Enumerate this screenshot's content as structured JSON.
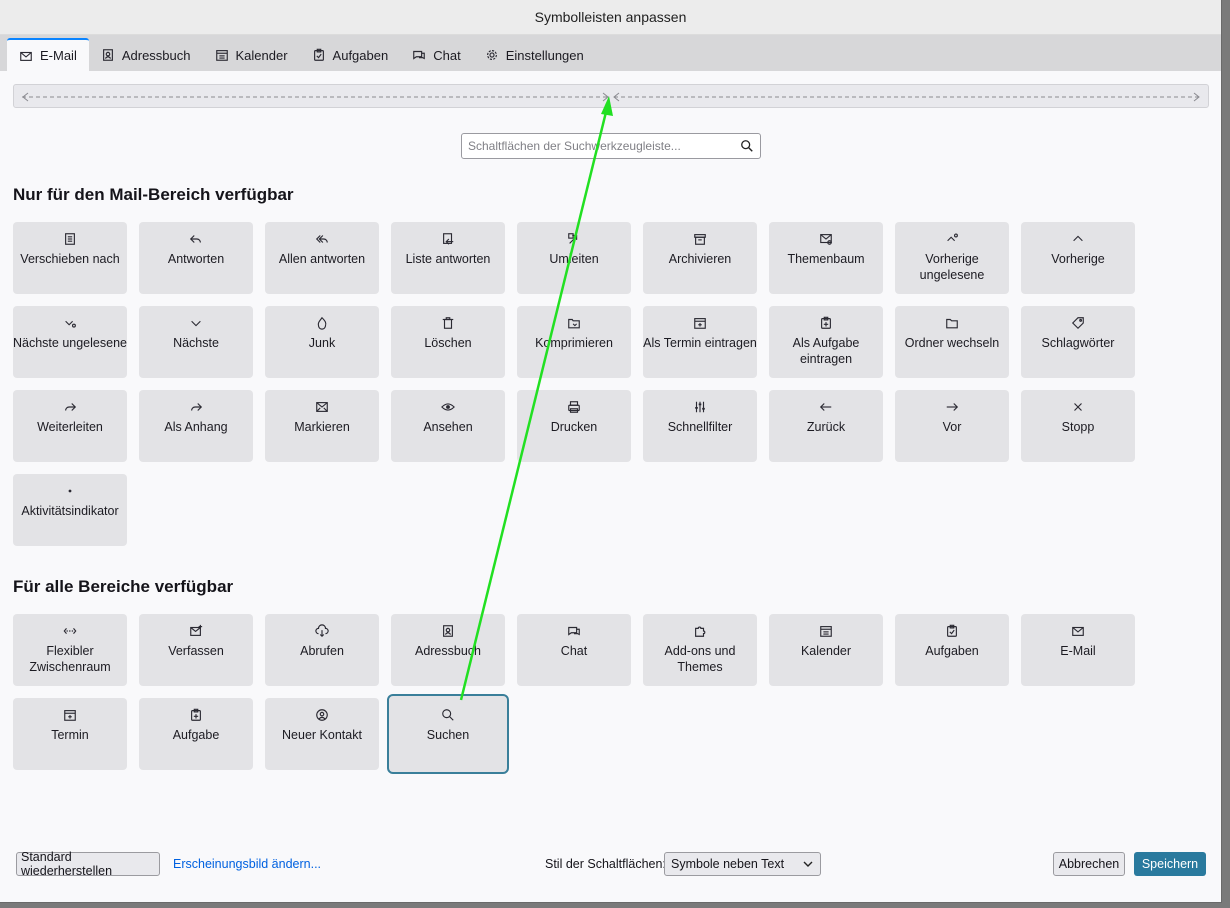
{
  "window": {
    "title": "Symbolleisten anpassen"
  },
  "tabs": [
    {
      "label": "E-Mail",
      "icon": "mail-icon",
      "active": true
    },
    {
      "label": "Adressbuch",
      "icon": "addressbook-icon"
    },
    {
      "label": "Kalender",
      "icon": "calendar-icon"
    },
    {
      "label": "Aufgaben",
      "icon": "tasks-icon"
    },
    {
      "label": "Chat",
      "icon": "chat-icon"
    },
    {
      "label": "Einstellungen",
      "icon": "gear-icon"
    }
  ],
  "search": {
    "placeholder": "Schaltflächen der Suchwerkzeugleiste..."
  },
  "section_mail": {
    "title": "Nur für den Mail-Bereich verfügbar",
    "items": [
      {
        "label": "Verschieben nach",
        "icon": "move-icon"
      },
      {
        "label": "Antworten",
        "icon": "reply-icon"
      },
      {
        "label": "Allen antworten",
        "icon": "reply-all-icon"
      },
      {
        "label": "Liste antworten",
        "icon": "reply-list-icon"
      },
      {
        "label": "Umleiten",
        "icon": "redirect-icon"
      },
      {
        "label": "Archivieren",
        "icon": "archive-icon"
      },
      {
        "label": "Themenbaum",
        "icon": "thread-icon"
      },
      {
        "label": "Vorherige ungelesene",
        "icon": "previous-unread-icon"
      },
      {
        "label": "Vorherige",
        "icon": "chevron-up-icon"
      },
      {
        "label": "Nächste ungelesene",
        "icon": "next-unread-icon"
      },
      {
        "label": "Nächste",
        "icon": "chevron-down-icon"
      },
      {
        "label": "Junk",
        "icon": "junk-icon"
      },
      {
        "label": "Löschen",
        "icon": "trash-icon"
      },
      {
        "label": "Komprimieren",
        "icon": "compact-icon"
      },
      {
        "label": "Als Termin eintragen",
        "icon": "event-icon"
      },
      {
        "label": "Als Aufgabe eintragen",
        "icon": "task-icon"
      },
      {
        "label": "Ordner wechseln",
        "icon": "folder-icon"
      },
      {
        "label": "Schlagwörter",
        "icon": "tag-icon"
      },
      {
        "label": "Weiterleiten",
        "icon": "forward-icon"
      },
      {
        "label": "Als Anhang",
        "icon": "forward-attachment-icon"
      },
      {
        "label": "Markieren",
        "icon": "mark-icon"
      },
      {
        "label": "Ansehen",
        "icon": "eye-icon"
      },
      {
        "label": "Drucken",
        "icon": "printer-icon"
      },
      {
        "label": "Schnellfilter",
        "icon": "filter-icon"
      },
      {
        "label": "Zurück",
        "icon": "arrow-left-icon"
      },
      {
        "label": "Vor",
        "icon": "arrow-right-icon"
      },
      {
        "label": "Stopp",
        "icon": "close-icon"
      },
      {
        "label": "Aktivitätsindikator",
        "icon": "activity-icon"
      }
    ]
  },
  "section_all": {
    "title": "Für alle Bereiche verfügbar",
    "items": [
      {
        "label": "Flexibler Zwischenraum",
        "icon": "flexible-space-icon"
      },
      {
        "label": "Verfassen",
        "icon": "compose-icon"
      },
      {
        "label": "Abrufen",
        "icon": "download-icon"
      },
      {
        "label": "Adressbuch",
        "icon": "addressbook-icon"
      },
      {
        "label": "Chat",
        "icon": "chat-icon"
      },
      {
        "label": "Add-ons und Themes",
        "icon": "addons-icon"
      },
      {
        "label": "Kalender",
        "icon": "calendar-icon"
      },
      {
        "label": "Aufgaben",
        "icon": "tasks-icon"
      },
      {
        "label": "E-Mail",
        "icon": "mail-icon"
      },
      {
        "label": "Termin",
        "icon": "event-icon"
      },
      {
        "label": "Aufgabe",
        "icon": "task-icon"
      },
      {
        "label": "Neuer Kontakt",
        "icon": "new-contact-icon"
      },
      {
        "label": "Suchen",
        "icon": "search-icon",
        "selected": true
      }
    ]
  },
  "footer": {
    "restore_label": "Standard wiederherstellen",
    "appearance_link": "Erscheinungsbild ändern...",
    "style_label": "Stil der Schaltflächen:",
    "style_value": "Symbole neben Text",
    "cancel_label": "Abbrechen",
    "save_label": "Speichern"
  },
  "colors": {
    "accent": "#2a7a9e",
    "drag_arrow": "#22e022",
    "tab_active_line": "#0a84ff"
  }
}
